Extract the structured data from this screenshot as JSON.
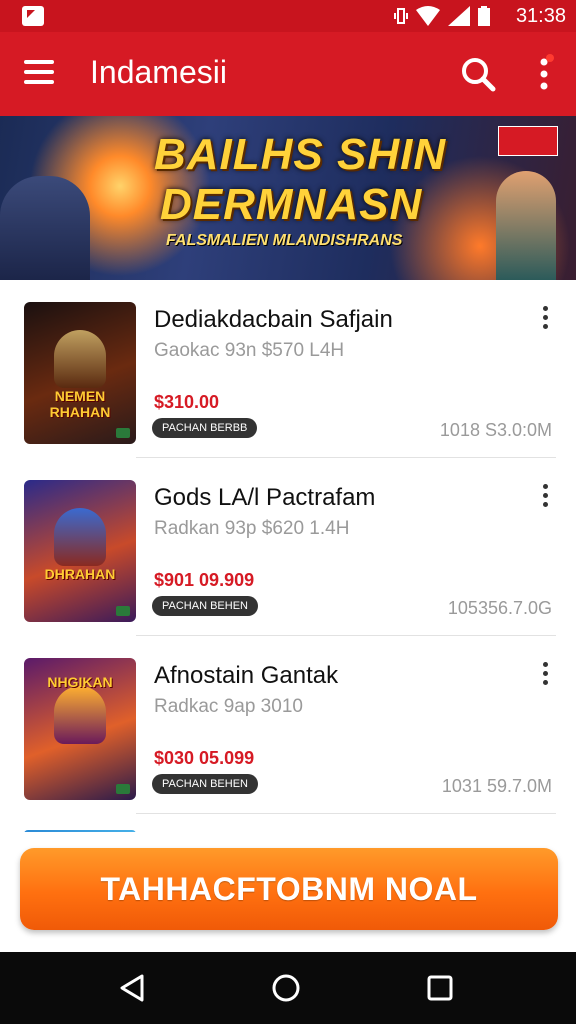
{
  "status_bar": {
    "time": "31:38"
  },
  "app_bar": {
    "title": "Indamesii",
    "icons": [
      "menu-icon",
      "search-icon",
      "more-vert-icon"
    ]
  },
  "banner": {
    "line1": "BAILHS SHIN",
    "line2": "DERMNASN",
    "subtitle": "FALSMALIEN MLANDISHRANS"
  },
  "items": [
    {
      "title": "Dediakdacbain Safjain",
      "subtitle": "Gaokac 93n $570 L4H",
      "price": "$310.00",
      "tag": "PACHAN BERBB",
      "meta": "1018 S3.0:0M",
      "thumb_label": "NEMEN RHAHAN",
      "thumb_colors": [
        "#1a1010",
        "#6a2a10",
        "#2a1a1a"
      ]
    },
    {
      "title": "Gods LA/l Pactrafam",
      "subtitle": "Radkan 93p $620 1.4H",
      "price": "$901 09.909",
      "tag": "PACHAN BEHEN",
      "meta": "105356.7.0G",
      "thumb_label": "DHRAHAN",
      "thumb_colors": [
        "#2a2a8a",
        "#c84a2a",
        "#3a1a5a"
      ]
    },
    {
      "title": "Afnostain Gantak",
      "subtitle": "Radkac 9ap 3010",
      "price": "$030 05.099",
      "tag": "PACHAN BEHEN",
      "meta": "1031 59.7.0M",
      "thumb_label": "NHGIKAN",
      "thumb_colors": [
        "#5a1a6a",
        "#e0602a",
        "#2a1a4a"
      ]
    }
  ],
  "cta": {
    "label": "TAHHACFTOBNM NOAL"
  },
  "nav_bar": {
    "icons": [
      "back-triangle-icon",
      "home-circle-icon",
      "recents-square-icon"
    ]
  },
  "colors": {
    "primary": "#d61a24",
    "status_bar": "#c8141e",
    "cta_orange": "#ff7a14",
    "price_red": "#d61a24"
  }
}
